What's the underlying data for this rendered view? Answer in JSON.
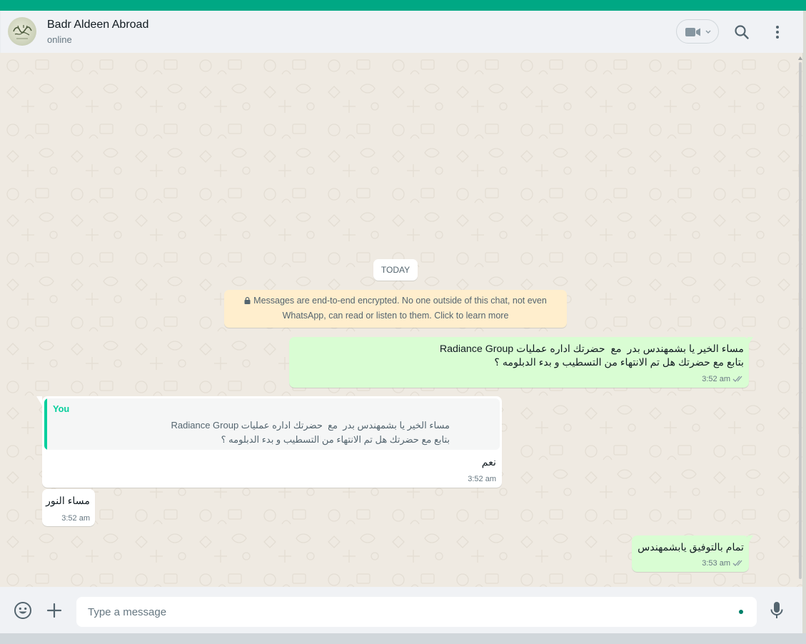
{
  "header": {
    "contact_name": "Badr Aldeen Abroad",
    "status": "online"
  },
  "chat": {
    "date_chip": "TODAY",
    "encryption_notice_line1": "Messages are end-to-end encrypted. No one outside of this chat, not even",
    "encryption_notice_line2": "WhatsApp, can read or listen to them. Click to learn more",
    "messages": [
      {
        "direction": "outgoing",
        "line1": "مساء الخير يا بشمهندس بدر  مع  حضرتك اداره عمليات Radiance Group",
        "line2": "بتابع مع حضرتك هل تم الانتهاء من التسطيب و بدء الدبلومه ؟",
        "time": "3:52 am",
        "status": "read"
      },
      {
        "direction": "incoming",
        "quote_author": "You",
        "quote_line1": "مساء الخير يا بشمهندس بدر  مع  حضرتك اداره عمليات Radiance Group",
        "quote_line2": "بتابع مع حضرتك هل تم الانتهاء من التسطيب و بدء الدبلومه ؟",
        "text": "نعم",
        "time": "3:52 am"
      },
      {
        "direction": "incoming",
        "text": "مساء النور",
        "time": "3:52 am"
      },
      {
        "direction": "outgoing",
        "text": "تمام بالتوفيق يابشمهندس",
        "time": "3:53 am",
        "status": "read"
      }
    ]
  },
  "composer": {
    "placeholder": "Type a message"
  },
  "icons": {
    "video": "video-camera-icon",
    "search": "search-icon",
    "menu": "kebab-menu-icon",
    "emoji": "emoji-icon",
    "attach": "plus-icon",
    "mic": "microphone-icon",
    "lock": "lock-icon",
    "ticks": "double-check-icon"
  },
  "colors": {
    "accent": "#00a884",
    "outgoing_bubble": "#d9fdd3",
    "incoming_bubble": "#ffffff",
    "read_ticks": "#8696a0",
    "quote_bar": "#06cf9c",
    "encryption_bg": "#ffeecd"
  }
}
